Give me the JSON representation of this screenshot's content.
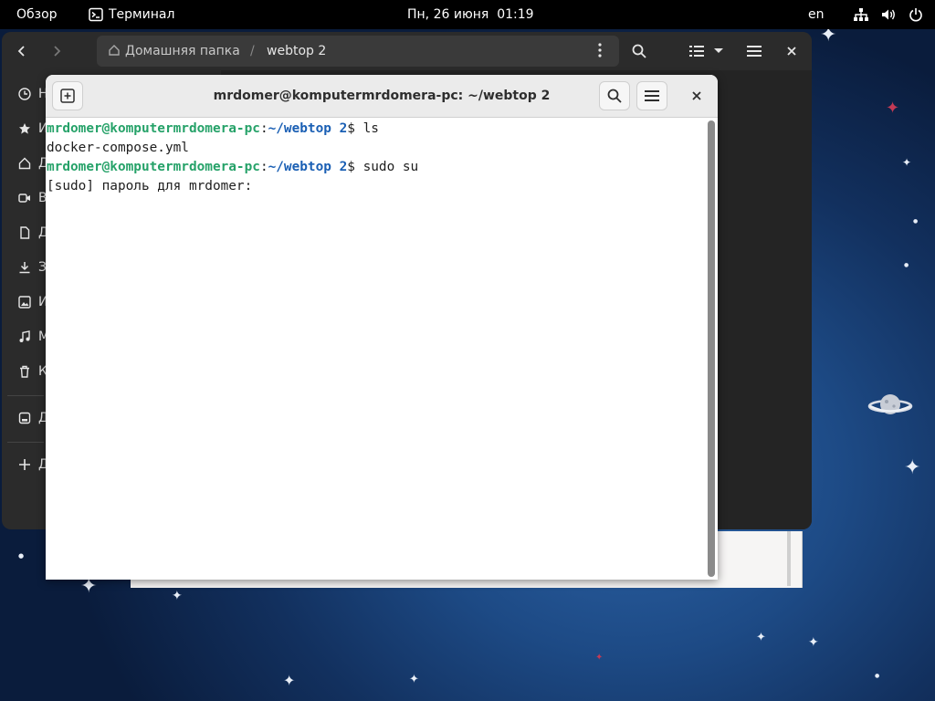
{
  "topbar": {
    "activities": "Обзор",
    "app_name": "Терминал",
    "datetime": "Пн, 26 июня  01:19",
    "keyboard_layout": "en"
  },
  "file_manager": {
    "breadcrumb": {
      "home_label": "Домашняя папка",
      "separator": "/",
      "current": "webtop 2"
    },
    "sidebar_labels": [
      "Н",
      "И",
      "Д",
      "В",
      "Д",
      "З",
      "И",
      "М",
      "К",
      "Д",
      "Д"
    ]
  },
  "terminal": {
    "title": "mrdomer@komputermrdomera-pc: ~/webtop 2",
    "lines": [
      {
        "user_host": "mrdomer@komputermrdomera-pc",
        "colon": ":",
        "path": "~/webtop 2",
        "rest": "$ ls"
      },
      {
        "output": "docker-compose.yml"
      },
      {
        "user_host": "mrdomer@komputermrdomera-pc",
        "colon": ":",
        "path": "~/webtop 2",
        "rest": "$ sudo su"
      },
      {
        "output": "[sudo] пароль для mrdomer: "
      }
    ]
  },
  "colors": {
    "prompt_user": "#26a269",
    "prompt_path": "#1a5fb4",
    "topbar": "#000000",
    "terminal_header": "#ebebeb"
  },
  "icons": {
    "topbar": [
      "terminal-app-icon",
      "network-icon",
      "volume-icon",
      "power-icon"
    ],
    "file_manager": [
      "back-icon",
      "forward-icon",
      "home-icon",
      "more-vertical-icon",
      "search-icon",
      "list-view-icon",
      "chevron-down-icon",
      "menu-icon",
      "close-icon"
    ],
    "terminal": [
      "new-tab-icon",
      "search-icon",
      "menu-icon",
      "close-icon"
    ]
  }
}
